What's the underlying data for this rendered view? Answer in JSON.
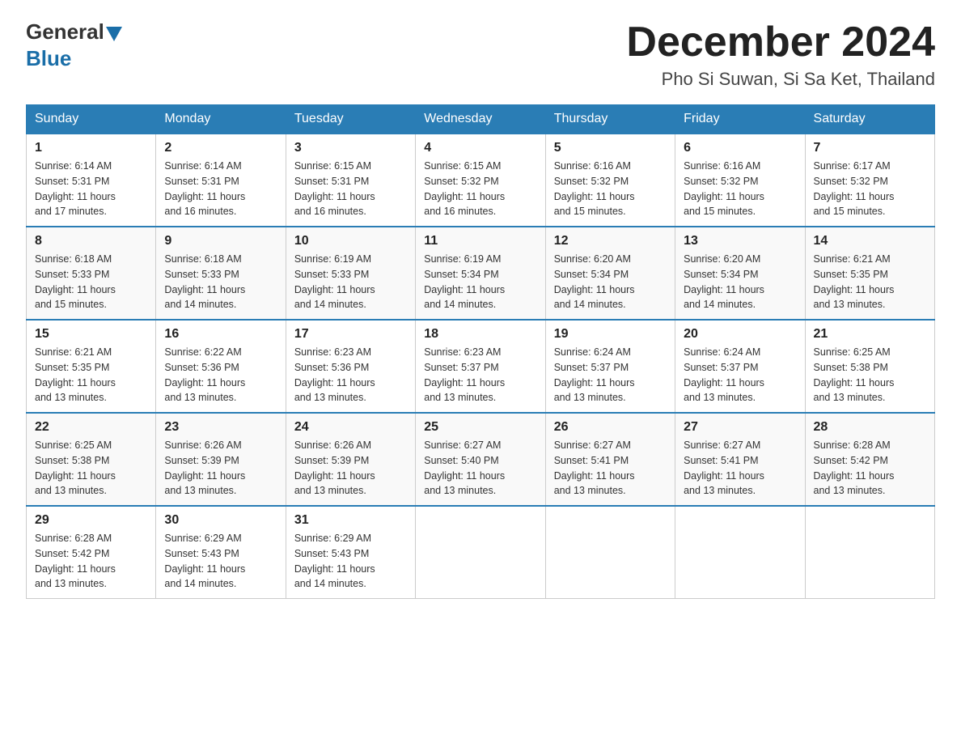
{
  "header": {
    "logo_general": "General",
    "logo_blue": "Blue",
    "month_title": "December 2024",
    "location": "Pho Si Suwan, Si Sa Ket, Thailand"
  },
  "days_of_week": [
    "Sunday",
    "Monday",
    "Tuesday",
    "Wednesday",
    "Thursday",
    "Friday",
    "Saturday"
  ],
  "weeks": [
    [
      {
        "day": "1",
        "sunrise": "6:14 AM",
        "sunset": "5:31 PM",
        "daylight": "11 hours and 17 minutes."
      },
      {
        "day": "2",
        "sunrise": "6:14 AM",
        "sunset": "5:31 PM",
        "daylight": "11 hours and 16 minutes."
      },
      {
        "day": "3",
        "sunrise": "6:15 AM",
        "sunset": "5:31 PM",
        "daylight": "11 hours and 16 minutes."
      },
      {
        "day": "4",
        "sunrise": "6:15 AM",
        "sunset": "5:32 PM",
        "daylight": "11 hours and 16 minutes."
      },
      {
        "day": "5",
        "sunrise": "6:16 AM",
        "sunset": "5:32 PM",
        "daylight": "11 hours and 15 minutes."
      },
      {
        "day": "6",
        "sunrise": "6:16 AM",
        "sunset": "5:32 PM",
        "daylight": "11 hours and 15 minutes."
      },
      {
        "day": "7",
        "sunrise": "6:17 AM",
        "sunset": "5:32 PM",
        "daylight": "11 hours and 15 minutes."
      }
    ],
    [
      {
        "day": "8",
        "sunrise": "6:18 AM",
        "sunset": "5:33 PM",
        "daylight": "11 hours and 15 minutes."
      },
      {
        "day": "9",
        "sunrise": "6:18 AM",
        "sunset": "5:33 PM",
        "daylight": "11 hours and 14 minutes."
      },
      {
        "day": "10",
        "sunrise": "6:19 AM",
        "sunset": "5:33 PM",
        "daylight": "11 hours and 14 minutes."
      },
      {
        "day": "11",
        "sunrise": "6:19 AM",
        "sunset": "5:34 PM",
        "daylight": "11 hours and 14 minutes."
      },
      {
        "day": "12",
        "sunrise": "6:20 AM",
        "sunset": "5:34 PM",
        "daylight": "11 hours and 14 minutes."
      },
      {
        "day": "13",
        "sunrise": "6:20 AM",
        "sunset": "5:34 PM",
        "daylight": "11 hours and 14 minutes."
      },
      {
        "day": "14",
        "sunrise": "6:21 AM",
        "sunset": "5:35 PM",
        "daylight": "11 hours and 13 minutes."
      }
    ],
    [
      {
        "day": "15",
        "sunrise": "6:21 AM",
        "sunset": "5:35 PM",
        "daylight": "11 hours and 13 minutes."
      },
      {
        "day": "16",
        "sunrise": "6:22 AM",
        "sunset": "5:36 PM",
        "daylight": "11 hours and 13 minutes."
      },
      {
        "day": "17",
        "sunrise": "6:23 AM",
        "sunset": "5:36 PM",
        "daylight": "11 hours and 13 minutes."
      },
      {
        "day": "18",
        "sunrise": "6:23 AM",
        "sunset": "5:37 PM",
        "daylight": "11 hours and 13 minutes."
      },
      {
        "day": "19",
        "sunrise": "6:24 AM",
        "sunset": "5:37 PM",
        "daylight": "11 hours and 13 minutes."
      },
      {
        "day": "20",
        "sunrise": "6:24 AM",
        "sunset": "5:37 PM",
        "daylight": "11 hours and 13 minutes."
      },
      {
        "day": "21",
        "sunrise": "6:25 AM",
        "sunset": "5:38 PM",
        "daylight": "11 hours and 13 minutes."
      }
    ],
    [
      {
        "day": "22",
        "sunrise": "6:25 AM",
        "sunset": "5:38 PM",
        "daylight": "11 hours and 13 minutes."
      },
      {
        "day": "23",
        "sunrise": "6:26 AM",
        "sunset": "5:39 PM",
        "daylight": "11 hours and 13 minutes."
      },
      {
        "day": "24",
        "sunrise": "6:26 AM",
        "sunset": "5:39 PM",
        "daylight": "11 hours and 13 minutes."
      },
      {
        "day": "25",
        "sunrise": "6:27 AM",
        "sunset": "5:40 PM",
        "daylight": "11 hours and 13 minutes."
      },
      {
        "day": "26",
        "sunrise": "6:27 AM",
        "sunset": "5:41 PM",
        "daylight": "11 hours and 13 minutes."
      },
      {
        "day": "27",
        "sunrise": "6:27 AM",
        "sunset": "5:41 PM",
        "daylight": "11 hours and 13 minutes."
      },
      {
        "day": "28",
        "sunrise": "6:28 AM",
        "sunset": "5:42 PM",
        "daylight": "11 hours and 13 minutes."
      }
    ],
    [
      {
        "day": "29",
        "sunrise": "6:28 AM",
        "sunset": "5:42 PM",
        "daylight": "11 hours and 13 minutes."
      },
      {
        "day": "30",
        "sunrise": "6:29 AM",
        "sunset": "5:43 PM",
        "daylight": "11 hours and 14 minutes."
      },
      {
        "day": "31",
        "sunrise": "6:29 AM",
        "sunset": "5:43 PM",
        "daylight": "11 hours and 14 minutes."
      },
      null,
      null,
      null,
      null
    ]
  ],
  "labels": {
    "sunrise": "Sunrise:",
    "sunset": "Sunset:",
    "daylight": "Daylight:"
  }
}
